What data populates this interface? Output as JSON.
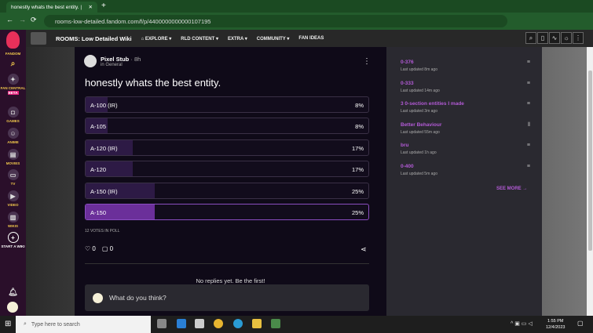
{
  "browser": {
    "tab_title": "honestly whats the best entity. |",
    "url": "rooms-low-detailed.fandom.com/f/p/4400000000000107195"
  },
  "nav": {
    "wiki_name": "ROOMS: Low Detailed Wiki",
    "items": [
      "EXPLORE",
      "RLD CONTENT",
      "EXTRA",
      "COMMUNITY",
      "FAN IDEAS"
    ]
  },
  "rail": {
    "fandom": "FANDOM",
    "items": [
      "FAN CENTRAL",
      "GAMES",
      "ANIME",
      "MOVIES",
      "TV",
      "VIDEO",
      "WIKIS",
      "START A WIKI"
    ],
    "beta": "BETA"
  },
  "post": {
    "author": "Pixel Stub",
    "time": "8h",
    "category": "in General",
    "title": "honestly whats the best entity.",
    "options": [
      {
        "label": "A-100 (IR)",
        "pct": "8%",
        "value": 8
      },
      {
        "label": "A-105",
        "pct": "8%",
        "value": 8
      },
      {
        "label": "A-120 (IR)",
        "pct": "17%",
        "value": 17
      },
      {
        "label": "A-120",
        "pct": "17%",
        "value": 17
      },
      {
        "label": "A-150 (IR)",
        "pct": "25%",
        "value": 25
      },
      {
        "label": "A-150",
        "pct": "25%",
        "value": 25
      }
    ],
    "votes": "12 VOTES IN POLL",
    "likes": "0",
    "comments": "0",
    "no_replies": "No replies yet. Be the first!",
    "reply_placeholder": "What do you think?"
  },
  "sidebar": {
    "items": [
      {
        "title": "0-376",
        "sub": "Last updated 8m ago"
      },
      {
        "title": "0-333",
        "sub": "Last updated 14m ago"
      },
      {
        "title": "3 0-section entities I made",
        "sub": "Last updated 3m ago"
      },
      {
        "title": "Better Behaviour",
        "sub": "Last updated 55m ago"
      },
      {
        "title": "bru",
        "sub": "Last updated 1h ago"
      },
      {
        "title": "0-400",
        "sub": "Last updated 5m ago"
      }
    ],
    "see_more": "SEE MORE"
  },
  "taskbar": {
    "search": "Type here to search",
    "time": "1:55 PM",
    "date": "12/4/2023"
  }
}
